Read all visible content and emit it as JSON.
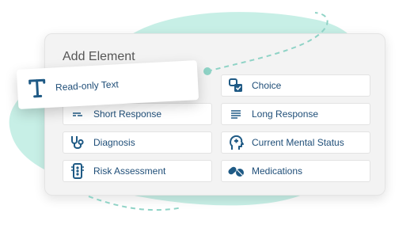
{
  "panel": {
    "title": "Add Element"
  },
  "dragging": {
    "label": "Read-only Text",
    "icon": "text-t-icon"
  },
  "elements": [
    {
      "label": "Choice",
      "icon": "choice-checkbox-icon"
    },
    {
      "label": "Short Response",
      "icon": "short-response-icon"
    },
    {
      "label": "Long Response",
      "icon": "long-response-icon"
    },
    {
      "label": "Diagnosis",
      "icon": "stethoscope-icon"
    },
    {
      "label": "Current Mental Status",
      "icon": "head-brain-icon"
    },
    {
      "label": "Risk Assessment",
      "icon": "traffic-light-icon"
    },
    {
      "label": "Medications",
      "icon": "pills-icon"
    }
  ],
  "colors": {
    "accent": "#1f5a85",
    "blob": "#c7efe6",
    "dashes": "#8fd3c6"
  }
}
